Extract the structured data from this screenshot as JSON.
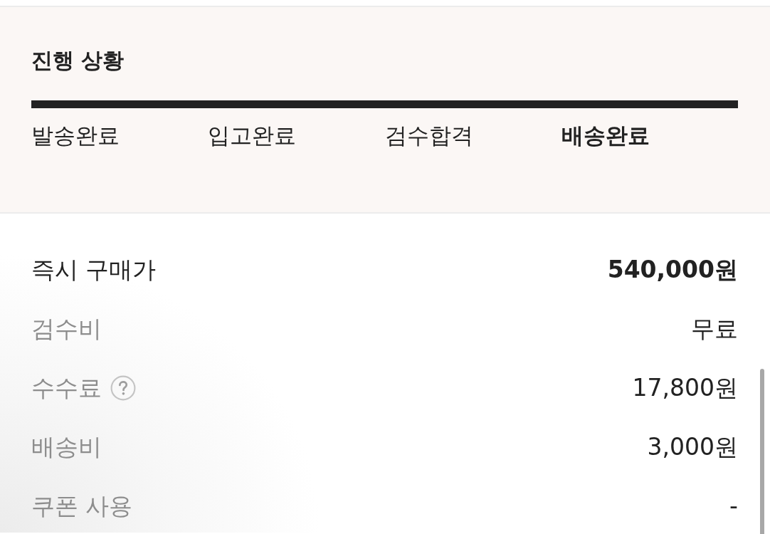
{
  "progress": {
    "title": "진행 상황",
    "level": 1,
    "steps": [
      {
        "label": "발송완료",
        "current": false
      },
      {
        "label": "입고완료",
        "current": false
      },
      {
        "label": "검수합격",
        "current": false
      },
      {
        "label": "배송완료",
        "current": true
      }
    ]
  },
  "price_rows": [
    {
      "kind": "total",
      "label": "즉시 구매가",
      "value": "540,000원",
      "help": false
    },
    {
      "kind": "fee",
      "label": "검수비",
      "value": "무료",
      "help": false
    },
    {
      "kind": "fee",
      "label": "수수료",
      "value": "17,800원",
      "help": true
    },
    {
      "kind": "fee",
      "label": "배송비",
      "value": "3,000원",
      "help": false
    },
    {
      "kind": "fee",
      "label": "쿠폰 사용",
      "value": "-",
      "help": false
    }
  ]
}
